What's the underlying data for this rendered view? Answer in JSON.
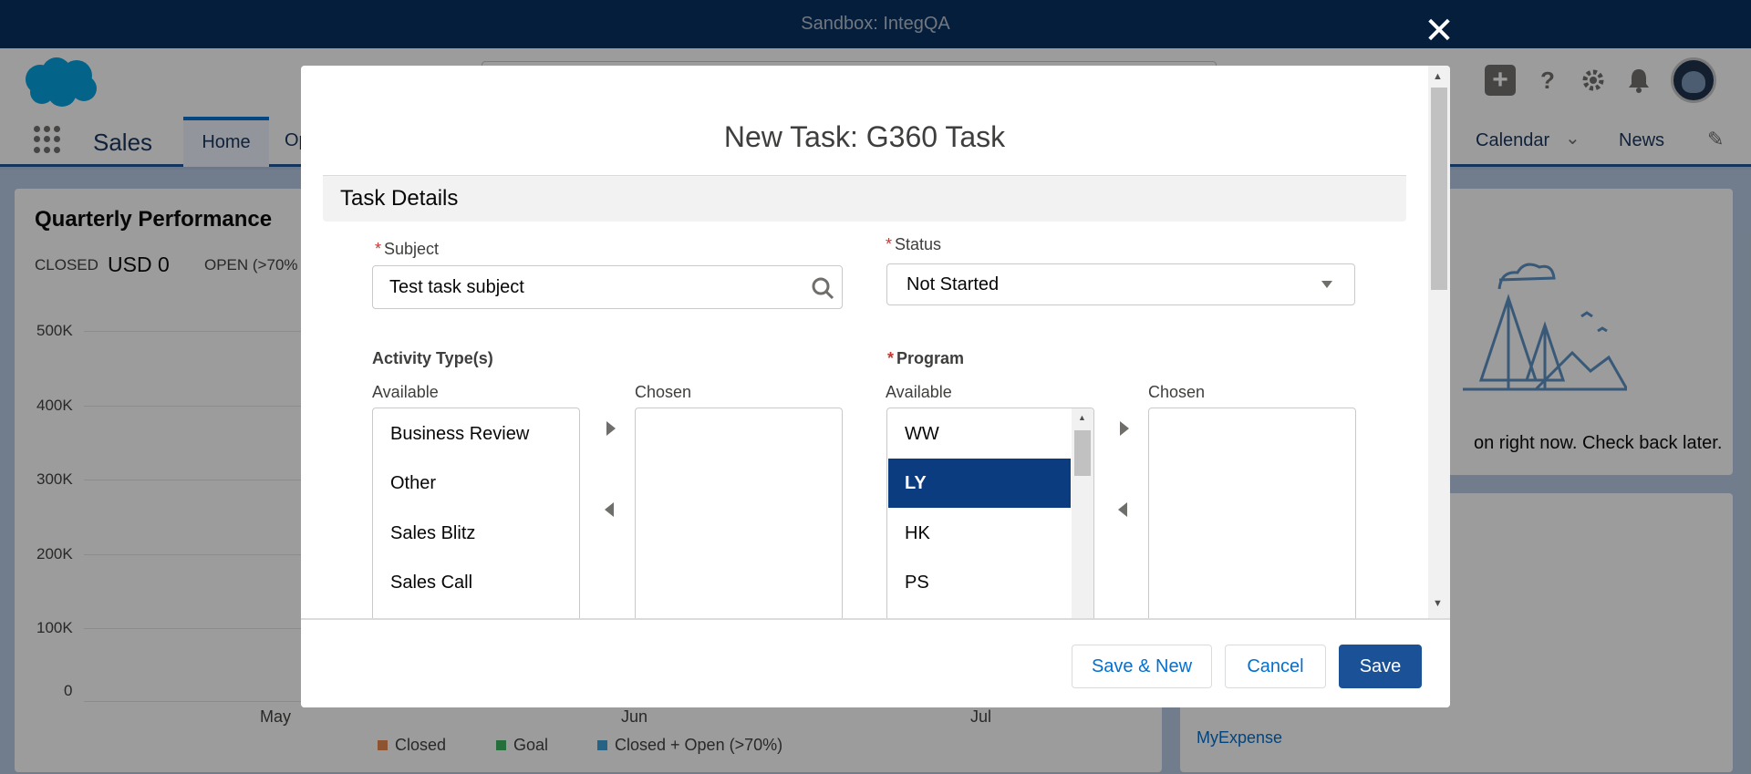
{
  "sandbox_bar": {
    "text": "Sandbox: IntegQA"
  },
  "nav": {
    "app_name": "Sales",
    "items": [
      {
        "label": "Home"
      },
      {
        "label": "Op"
      },
      {
        "label": "Calendar"
      },
      {
        "label": "News"
      }
    ]
  },
  "performance_card": {
    "title": "Quarterly Performance",
    "closed_label": "CLOSED",
    "closed_value": "USD 0",
    "open_label": "OPEN (>70%",
    "y_ticks": [
      "500K",
      "400K",
      "300K",
      "200K",
      "100K",
      "0"
    ],
    "x_ticks": [
      "May",
      "Jun",
      "Jul"
    ],
    "legend": [
      {
        "label": "Closed",
        "color": "#e8874d"
      },
      {
        "label": "Goal",
        "color": "#3bb25f"
      },
      {
        "label": "Closed + Open (>70%)",
        "color": "#3a9fd6"
      }
    ]
  },
  "right_card": {
    "empty_message": "on right now. Check back later."
  },
  "right_card2": {
    "link": "MyExpense"
  },
  "modal": {
    "close_icon": "close-icon",
    "title": "New Task: G360 Task",
    "section_title": "Task Details",
    "subject": {
      "required_mark": "*",
      "label": "Subject",
      "value": "Test task subject"
    },
    "status": {
      "required_mark": "*",
      "label": "Status",
      "value": "Not Started"
    },
    "activity_types": {
      "label": "Activity Type(s)",
      "available_label": "Available",
      "chosen_label": "Chosen",
      "available": [
        "Business Review",
        "Other",
        "Sales Blitz",
        "Sales Call"
      ]
    },
    "program": {
      "required_mark": "*",
      "label": "Program",
      "available_label": "Available",
      "chosen_label": "Chosen",
      "available": [
        "WW",
        "LY",
        "HK",
        "PS"
      ],
      "selected": "LY"
    },
    "footer": {
      "save_new": "Save & New",
      "cancel": "Cancel",
      "save": "Save"
    }
  }
}
